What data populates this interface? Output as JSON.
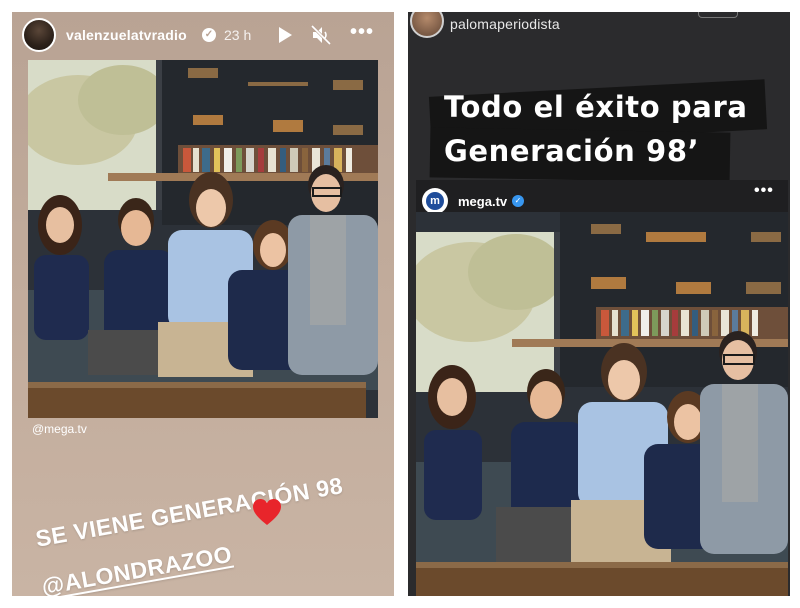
{
  "left_story": {
    "username": "valenzuelatvradio",
    "time_ago": "23 h",
    "verified_icon": "verified-check-icon",
    "controls": [
      "play-icon",
      "mute-icon",
      "more-icon"
    ],
    "photo_credit": "@mega.tv",
    "caption_line1": "SE VIENE GENERACIÓN 98",
    "caption_line2": "@ALONDRAZOO",
    "heart_icon": "heart-icon",
    "heart_color": "#e8252b"
  },
  "right_story": {
    "username": "palomaperiodista",
    "title_line1": "Todo el éxito para",
    "title_line2": "Generación 98’",
    "embedded_post": {
      "account": "mega.tv",
      "verified_color": "#3897f0",
      "brand_color": "#1f4d9b"
    }
  },
  "more_glyph": "•••"
}
